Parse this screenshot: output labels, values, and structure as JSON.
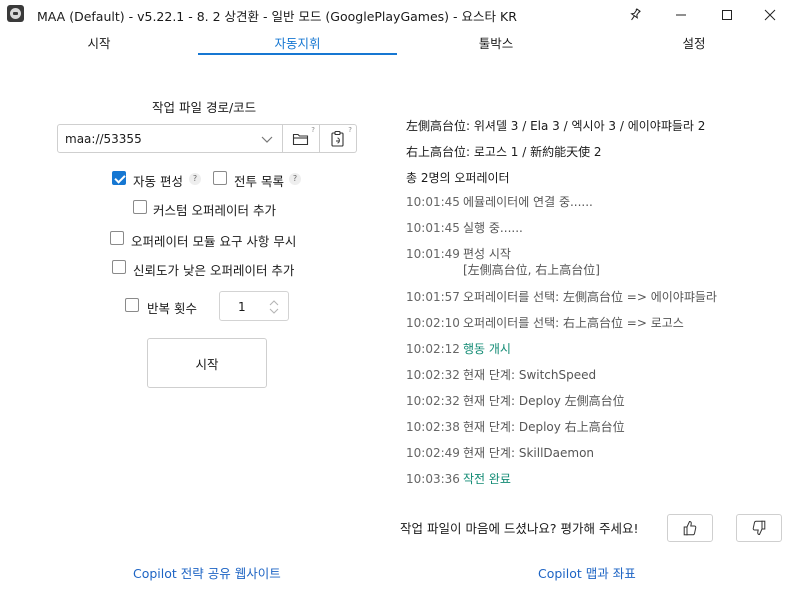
{
  "window": {
    "title": "MAA (Default) - v5.22.1 -  8. 2 상견환 - 일반 모드 (GooglePlayGames) - 요스타 KR"
  },
  "tabs": [
    "시작",
    "자동지휘",
    "툴박스",
    "설정"
  ],
  "active_tab": "자동지휘",
  "left": {
    "file_label": "작업 파일 경로/코드",
    "file_value": "maa://53355",
    "auto_formation": {
      "label": "자동 편성",
      "checked": true,
      "help": "?"
    },
    "battle_list": {
      "label": "전투 목록",
      "checked": false,
      "help": "?"
    },
    "custom_operator": {
      "label": "커스텀 오퍼레이터 추가",
      "checked": false
    },
    "ignore_module": {
      "label": "오퍼레이터 모듈 요구 사항 무시",
      "checked": false
    },
    "low_trust": {
      "label": "신뢰도가 낮은 오퍼레이터 추가",
      "checked": false
    },
    "repeat": {
      "label": "반복 횟수",
      "checked": false,
      "value": "1"
    },
    "start_button": "시작",
    "copilot_link": "Copilot 전략 공유 웹사이트"
  },
  "right": {
    "info_lines": [
      "左側高台位: 위셔델 3 / Ela 3 / 엑시아 3 / 에이야퍄들라 2",
      "右上高台位: 로고스 1 / 新約能天使 2",
      "총 2명의 오퍼레이터"
    ],
    "logs": [
      {
        "time": "10:01:45",
        "msg": "에뮬레이터에 연결 중......",
        "green": false
      },
      {
        "time": "10:01:45",
        "msg": "실행 중......",
        "green": false
      },
      {
        "time": "10:01:49",
        "msg": "편성 시작",
        "msg2": "[左側高台位, 右上高台位]",
        "green": false
      },
      {
        "time": "10:01:57",
        "msg": "오퍼레이터를 선택: 左側高台位 => 에이야퍄들라",
        "green": false
      },
      {
        "time": "10:02:10",
        "msg": "오퍼레이터를 선택: 右上高台位 => 로고스",
        "green": false
      },
      {
        "time": "10:02:12",
        "msg": "행동 개시",
        "green": true
      },
      {
        "time": "10:02:32",
        "msg": "현재 단계: SwitchSpeed",
        "green": false
      },
      {
        "time": "10:02:32",
        "msg": "현재 단계: Deploy 左側高台位",
        "green": false
      },
      {
        "time": "10:02:38",
        "msg": "현재 단계: Deploy 右上高台位",
        "green": false
      },
      {
        "time": "10:02:49",
        "msg": "현재 단계: SkillDaemon",
        "green": false
      },
      {
        "time": "10:03:36",
        "msg": "작전 완료",
        "green": true
      }
    ],
    "rate_prompt": "작업 파일이 마음에 드셨나요? 평가해 주세요!",
    "map_link": "Copilot 맵과 좌표"
  },
  "colors": {
    "accent": "#1677d2",
    "link": "#1d64c4",
    "log_green": "#128b74"
  },
  "icons": [
    "app-icon",
    "pin-icon",
    "minimize-icon",
    "maximize-icon",
    "close-icon",
    "chevron-down-icon",
    "folder-icon",
    "clipboard-icon",
    "thumbs-up-icon",
    "thumbs-down-icon"
  ]
}
